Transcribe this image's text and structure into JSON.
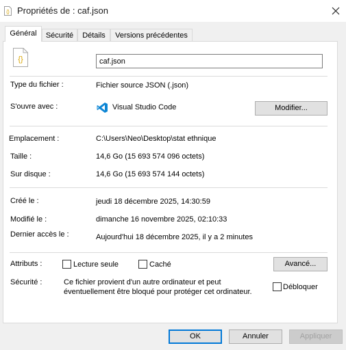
{
  "window": {
    "title": "Propriétés de : caf.json"
  },
  "tabs": [
    {
      "label": "Général"
    },
    {
      "label": "Sécurité"
    },
    {
      "label": "Détails"
    },
    {
      "label": "Versions précédentes"
    }
  ],
  "file": {
    "name": "caf.json"
  },
  "general": {
    "type_label": "Type du fichier :",
    "type_value": "Fichier source JSON (.json)",
    "opens_label": "S'ouvre avec :",
    "opens_app": "Visual Studio Code",
    "modify_button": "Modifier...",
    "location_label": "Emplacement :",
    "location_value": "C:\\Users\\Neo\\Desktop\\stat ethnique",
    "size_label": "Taille :",
    "size_value": "14,6 Go (15 693 574 096 octets)",
    "disk_label": "Sur disque :",
    "disk_value": "14,6 Go (15 693 574 144 octets)",
    "created_label": "Créé le :",
    "created_value": "jeudi 18 décembre 2025, 14:30:59",
    "modified_label": "Modifié le :",
    "modified_value": "dimanche 16 novembre 2025, 02:10:33",
    "accessed_label": "Dernier accès le :",
    "accessed_value": "Aujourd'hui 18 décembre 2025, il y a 2 minutes",
    "attributes_label": "Attributs :",
    "readonly_label": "Lecture seule",
    "readonly_checked": false,
    "hidden_label": "Caché",
    "hidden_checked": false,
    "advanced_button": "Avancé...",
    "security_label": "Sécurité :",
    "security_line1": "Ce fichier provient d'un autre ordinateur et peut",
    "security_line2": "éventuellement être bloqué pour protéger cet ordinateur.",
    "unblock_label": "Débloquer",
    "unblock_checked": false
  },
  "footer": {
    "ok": "OK",
    "cancel": "Annuler",
    "apply": "Appliquer"
  },
  "colors": {
    "accent": "#0078d7",
    "vscode_blue": "#0e86d4",
    "json_icon": "#d9a400"
  }
}
